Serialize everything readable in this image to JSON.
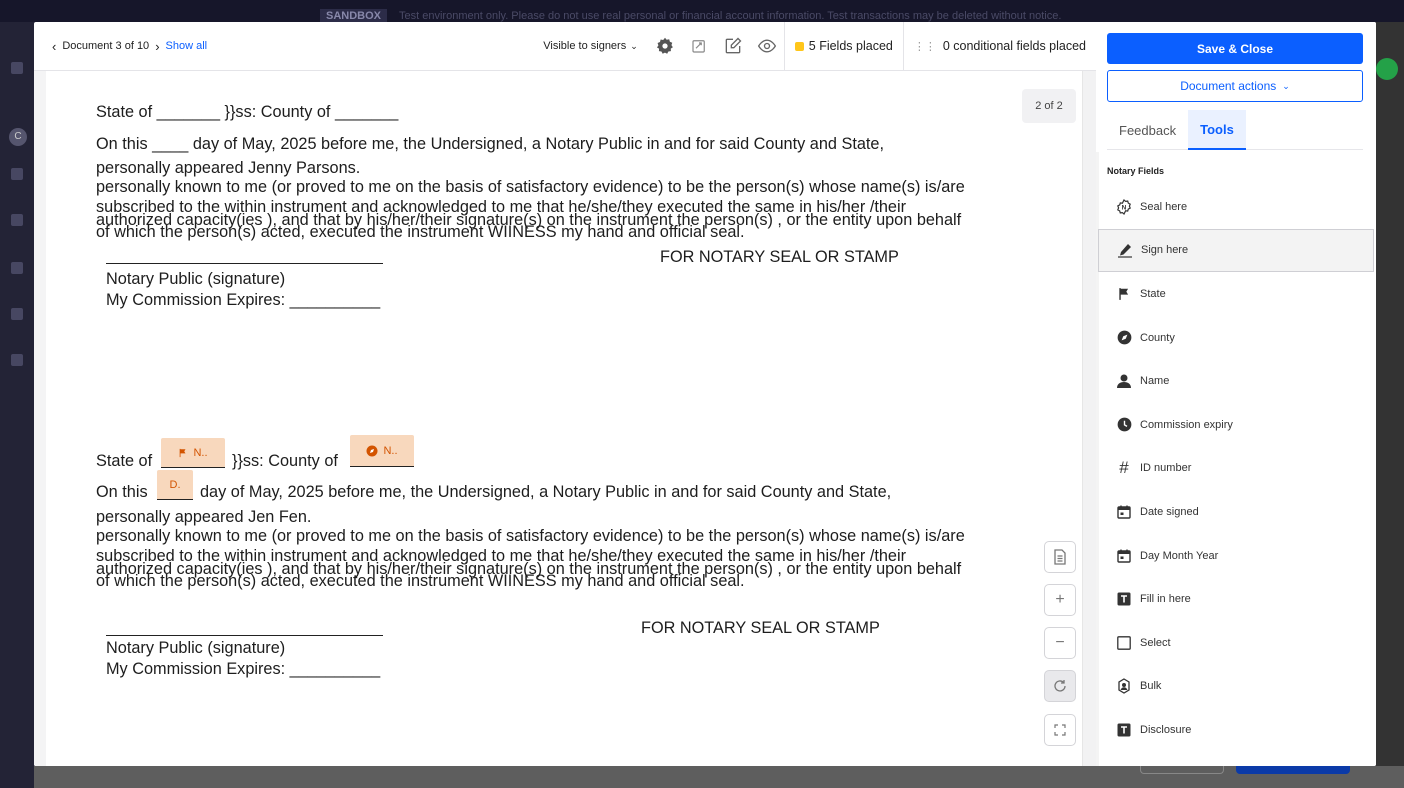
{
  "background": {
    "banner_tag": "SANDBOX",
    "banner_text": "Test environment only. Please do not use real personal or financial account information. Test transactions may be deleted without notice."
  },
  "toolbar": {
    "document_position": "Document 3 of 10",
    "show_all": "Show all",
    "visibility": "Visible to signers",
    "fields_placed": "5 Fields placed",
    "conditional_fields": "0 conditional fields placed"
  },
  "document": {
    "page_indicator": "2 of 2",
    "block1": {
      "state_line": "State of _______ }}ss: County of _______",
      "day_line": "On this ____ day of May, 2025 before me, the Undersigned, a Notary Public in and for said County and State,",
      "appeared": "personally appeared Jenny Parsons.",
      "known": "personally known to me (or proved to me on the basis of satisfactory evidence) to be the person(s) whose name(s) is/are",
      "subscribed": "subscribed to the within instrument and acknowledged to me that he/she/they executed the same in his/her /their",
      "authorized": "authorized  capacity(ies ), and that by his/her/their signature(s) on the instrument the person(s) , or the entity upon behalf",
      "which": "of which the person(s) acted, executed the instrument WIINESS my hand and official seal.",
      "seal": "FOR NOTARY SEAL OR STAMP",
      "notary_sig": "Notary Public (signature)",
      "expires": "My Commission Expires: __________"
    },
    "block2": {
      "state_prefix": "State of",
      "state_mid": "}}ss: County of",
      "day_prefix": "On this",
      "day_rest": "day of May, 2025 before me, the Undersigned, a Notary Public in and for said County and State,",
      "appeared": "personally appeared Jen Fen.",
      "known": "personally known to me (or proved to me on the basis of satisfactory evidence) to be the person(s) whose name(s) is/are",
      "subscribed": "subscribed to the within instrument and acknowledged to me that he/she/they executed the same in his/her /their",
      "authorized": "authorized  capacity(ies ), and that by his/her/their signature(s) on the instrument the person(s) , or the entity upon behalf",
      "which": "of which the person(s) acted, executed the instrument WIINESS my hand and official seal.",
      "seal": "FOR NOTARY SEAL OR STAMP",
      "notary_sig": "Notary Public (signature)",
      "expires": "My Commission Expires: __________"
    },
    "placed_fields": {
      "state_field": "N..",
      "county_field": "N..",
      "day_field": "D."
    },
    "zoom_controls": [
      "file-icon",
      "zoom-in",
      "zoom-out",
      "reset",
      "fit"
    ]
  },
  "panel": {
    "save_close": "Save & Close",
    "document_actions": "Document actions",
    "tabs": [
      "Feedback",
      "Tools"
    ],
    "active_tab": "Tools",
    "section_title": "Notary Fields",
    "items": [
      {
        "label": "Seal here",
        "icon": "seal-icon"
      },
      {
        "label": "Sign here",
        "icon": "pen-icon"
      },
      {
        "label": "State",
        "icon": "flag-icon"
      },
      {
        "label": "County",
        "icon": "compass-icon"
      },
      {
        "label": "Name",
        "icon": "person-icon"
      },
      {
        "label": "Commission expiry",
        "icon": "clock-icon"
      },
      {
        "label": "ID number",
        "icon": "hash-icon"
      },
      {
        "label": "Date signed",
        "icon": "calendar-icon"
      },
      {
        "label": "Day Month Year",
        "icon": "calendar-icon"
      },
      {
        "label": "Fill in here",
        "icon": "text-box-icon"
      },
      {
        "label": "Select",
        "icon": "checkbox-icon"
      },
      {
        "label": "Bulk",
        "icon": "bulk-icon"
      },
      {
        "label": "Disclosure",
        "icon": "text-box-icon"
      }
    ],
    "selected_item": "Sign here"
  },
  "colors": {
    "primary": "#0b5fff",
    "field_fill": "#f8d8bd",
    "field_text": "#d35400",
    "fields_badge": "#ffc61a"
  }
}
